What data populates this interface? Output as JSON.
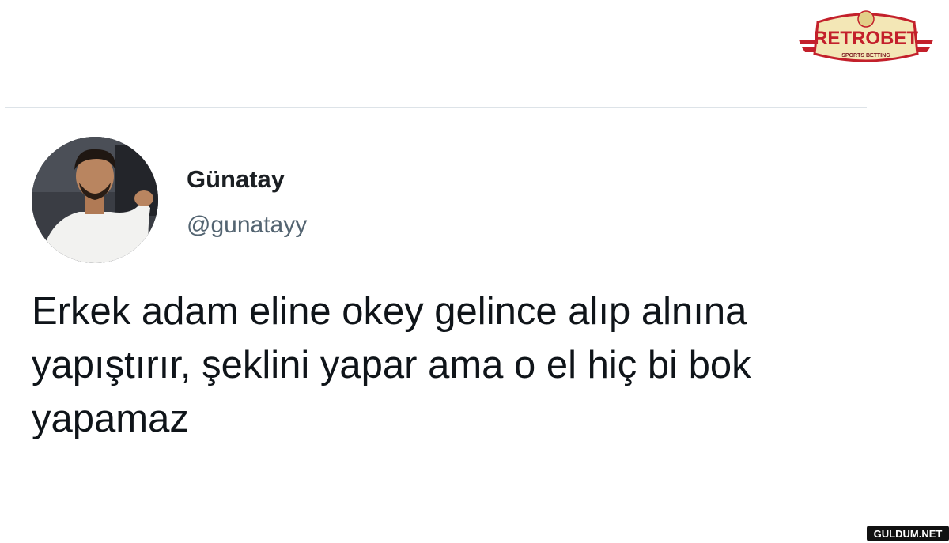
{
  "tweet": {
    "display_name": "Günatay",
    "handle": "@gunatayy",
    "text": "Erkek adam eline okey gelince alıp alnına yapıştırır, şeklini yapar ama o el hiç bi bok yapamaz",
    "avatar_icon": "profile-photo"
  },
  "branding": {
    "logo_text": "RETROBET",
    "logo_tagline": "SPORTS BETTING",
    "logo_colors": {
      "badge": "#f3e7b6",
      "text": "#c3202b",
      "stripes": "#c3202b"
    },
    "watermark_text": "GULDUM.NET"
  }
}
